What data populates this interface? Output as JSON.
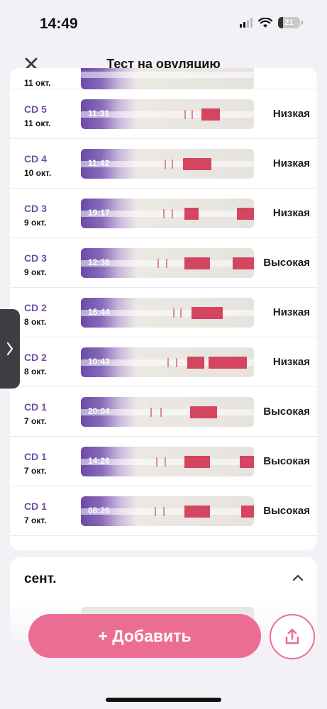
{
  "status_bar": {
    "time": "14:49",
    "battery": "21"
  },
  "nav": {
    "title": "Тест на овуляцию"
  },
  "partial_row": {
    "date": "11 окт."
  },
  "tests": [
    {
      "cd": "CD 5",
      "date": "11 окт.",
      "time": "11:31",
      "level": "Низкая"
    },
    {
      "cd": "CD 4",
      "date": "10 окт.",
      "time": "11:42",
      "level": "Низкая"
    },
    {
      "cd": "CD 3",
      "date": "9 окт.",
      "time": "19:17",
      "level": "Низкая"
    },
    {
      "cd": "CD 3",
      "date": "9 окт.",
      "time": "12:38",
      "level": "Высокая"
    },
    {
      "cd": "CD 2",
      "date": "8 окт.",
      "time": "16:44",
      "level": "Низкая"
    },
    {
      "cd": "CD 2",
      "date": "8 окт.",
      "time": "10:43",
      "level": "Низкая"
    },
    {
      "cd": "CD 1",
      "date": "7 окт.",
      "time": "20:04",
      "level": "Высокая"
    },
    {
      "cd": "CD 1",
      "date": "7 окт.",
      "time": "14:26",
      "level": "Высокая"
    },
    {
      "cd": "CD 1",
      "date": "7 окт.",
      "time": "08:26",
      "level": "Высокая"
    }
  ],
  "section": {
    "title": "сент."
  },
  "actions": {
    "add_label": "+ Добавить"
  },
  "colors": {
    "accent": "#ec6d93",
    "purple": "#6e4ea7",
    "background": "#f3f1f5"
  },
  "icons": [
    "close-icon",
    "chevron-up-icon",
    "share-icon",
    "chevron-right-icon",
    "wifi-icon",
    "signal-icon",
    "battery-icon"
  ]
}
